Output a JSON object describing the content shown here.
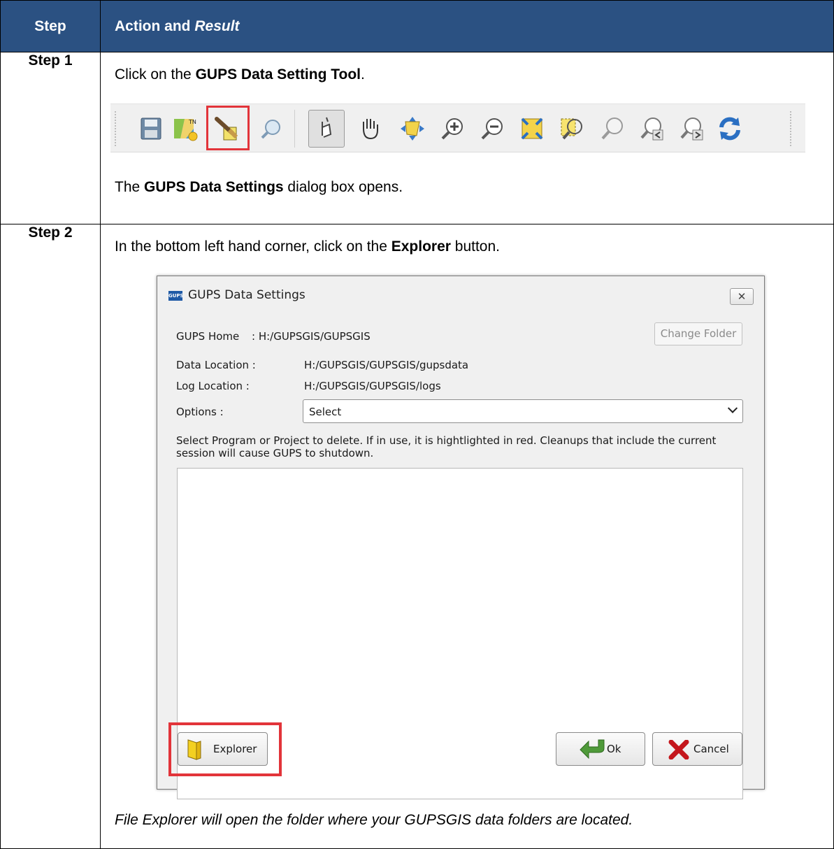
{
  "header": {
    "step": "Step",
    "action_prefix": "Action and ",
    "action_italic": "Result"
  },
  "rows": [
    {
      "step": "Step 1",
      "instruction": {
        "before": "Click on the ",
        "bold": "GUPS Data Setting Tool",
        "after": "."
      },
      "toolbar": {
        "icons": [
          "save-icon",
          "map-icon",
          "gups-data-setting-tool-icon",
          "identify-icon",
          "select-pointer-icon",
          "pan-hand-icon",
          "pan-to-selection-icon",
          "zoom-in-icon",
          "zoom-out-icon",
          "zoom-full-icon",
          "zoom-to-selection-icon",
          "zoom-to-layer-icon",
          "zoom-last-icon",
          "zoom-next-icon",
          "refresh-icon"
        ]
      },
      "result": {
        "before": "The ",
        "bold": "GUPS Data Settings",
        "after": " dialog box opens."
      }
    },
    {
      "step": "Step 2",
      "instruction": {
        "before": "In the bottom left hand corner, click on the ",
        "bold": "Explorer",
        "after": " button."
      },
      "dialog": {
        "title": "GUPS Data Settings",
        "logo_text": "GUPS",
        "close_glyph": "✕",
        "gups_home_label": "GUPS Home",
        "gups_home_value": ": H:/GUPSGIS/GUPSGIS",
        "change_folder": "Change Folder",
        "data_location_label": "Data Location  :",
        "data_location_value": "H:/GUPSGIS/GUPSGIS/gupsdata",
        "log_location_label": "Log Location  :",
        "log_location_value": "H:/GUPSGIS/GUPSGIS/logs",
        "options_label": "Options :",
        "options_value": "Select",
        "description": "Select Program or Project to delete. If in use, it is hightlighted in red. Cleanups that include the current session will cause GUPS to shutdown.",
        "explorer_button": "Explorer",
        "ok_button": "Ok",
        "cancel_button": "Cancel"
      },
      "result": {
        "italic": "File Explorer will open the folder where your GUPSGIS data folders are located."
      }
    }
  ],
  "colors": {
    "header_bg": "#2b5182",
    "highlight": "#e2343a"
  }
}
